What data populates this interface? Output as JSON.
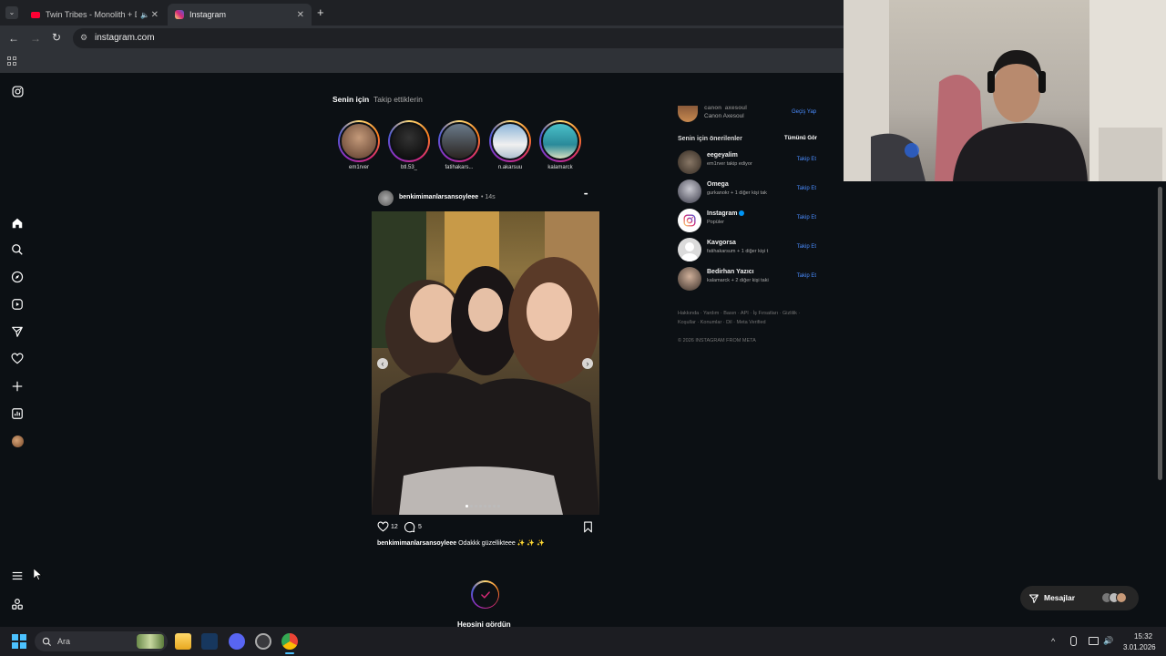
{
  "browser": {
    "tabs": [
      {
        "title": "Twin Tribes - Monolith + D",
        "close": "✕"
      },
      {
        "title": "Instagram",
        "close": "✕"
      }
    ],
    "new_tab": "+",
    "url": "instagram.com"
  },
  "feed": {
    "tabs": [
      "Senin için",
      "Takip ettiklerin"
    ],
    "stories": [
      {
        "name": "em1rver"
      },
      {
        "name": "btl.53_"
      },
      {
        "name": "fatihakars..."
      },
      {
        "name": "n.akarsuu"
      },
      {
        "name": "kalamarck"
      }
    ],
    "post": {
      "username": "benkimimanlarsansoyleee",
      "time": "• 14s",
      "more": "•••",
      "likes": "12",
      "comments": "5",
      "caption_user": "benkimimanlarsansoyleee",
      "caption_text": "Odakkk güzellikteee ✨ ✨ ✨"
    },
    "all_seen": "Hepsini gördün"
  },
  "right": {
    "account": {
      "username": "canon_axesoul",
      "name": "Canon Axesoul",
      "switch": "Geçiş Yap"
    },
    "suggestions_title": "Senin için önerilenler",
    "see_all": "Tümünü Gör",
    "suggestions": [
      {
        "name": "eegeyalim",
        "sub": "em1rver takip ediyor",
        "follow": "Takip Et"
      },
      {
        "name": "Omega",
        "sub": "gurkanokr + 1 diğer kişi tak",
        "follow": "Takip Et"
      },
      {
        "name": "Instagram",
        "sub": "Popüler",
        "follow": "Takip Et"
      },
      {
        "name": "Kavgorsa",
        "sub": "fatihakarsum + 1 diğer kişi t",
        "follow": "Takip Et"
      },
      {
        "name": "Bedirhan Yazıcı",
        "sub": "kalamarck + 2 diğer kişi taki",
        "follow": "Takip Et"
      }
    ],
    "footer_line1": "Hakkında · Yardım · Basın · API · İş Fırsatları · Gizlilik ·",
    "footer_line2": "Koşullar · Konumlar · Dil · Meta Verified",
    "copyright": "© 2026 INSTAGRAM FROM META"
  },
  "messages": {
    "label": "Mesajlar"
  },
  "taskbar": {
    "search_placeholder": "Ara",
    "time": "15:32",
    "date": "3.01.2026"
  },
  "colors": {
    "accent": "#4a8cff",
    "bg": "#0c1014",
    "verified": "#0095f6"
  }
}
